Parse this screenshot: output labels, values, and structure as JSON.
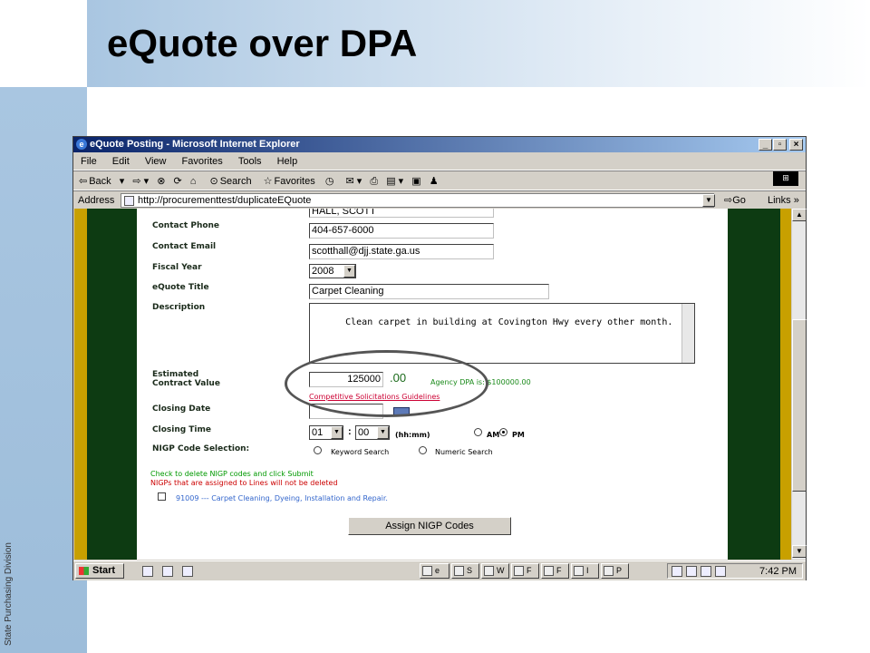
{
  "slide": {
    "title": "eQuote over DPA",
    "sidebar_label": "State Purchasing Division"
  },
  "window": {
    "title": "eQuote Posting - Microsoft Internet Explorer",
    "menu": [
      "File",
      "Edit",
      "View",
      "Favorites",
      "Tools",
      "Help"
    ],
    "toolbar": {
      "back": "Back",
      "search": "Search",
      "favorites": "Favorites"
    },
    "address": {
      "label": "Address",
      "url": "http://procurementtest/duplicateEQuote",
      "go": "Go",
      "links": "Links"
    }
  },
  "form": {
    "contact_name_value": "HALL, SCOTT",
    "contact_phone_label": "Contact Phone",
    "contact_phone_value": "404-657-6000",
    "contact_email_label": "Contact Email",
    "contact_email_value": "scotthall@djj.state.ga.us",
    "fiscal_year_label": "Fiscal Year",
    "fiscal_year_value": "2008",
    "equote_title_label": "eQuote Title",
    "equote_title_value": "Carpet Cleaning",
    "description_label": "Description",
    "description_value": "Clean carpet in building at Covington Hwy every other month.",
    "estimated_label_1": "Estimated",
    "estimated_label_2": "Contract Value",
    "estimated_value": "125000",
    "cents": ".00",
    "agency_dpa": "Agency DPA is: $100000.00",
    "guidelines_link": "Competitive Solicitations Guidelines",
    "closing_date_label": "Closing Date",
    "closing_time_label": "Closing Time",
    "hour_value": "01",
    "minute_value": "00",
    "time_colon": ":",
    "time_format": "(hh:mm)",
    "am_label": "AM",
    "pm_label": "PM",
    "nigp_label": "NIGP Code Selection:",
    "keyword_search": "Keyword Search",
    "numeric_search": "Numeric Search",
    "note_1": "Check to delete NIGP codes and click Submit",
    "note_2": "NIGPs that are assigned to Lines will not be deleted",
    "nigp_item": "91009 --- Carpet Cleaning, Dyeing, Installation and Repair.",
    "assign_button": "Assign NIGP Codes"
  },
  "taskbar": {
    "start": "Start",
    "buttons": [
      "e",
      "S",
      "W",
      "F",
      "F",
      "I",
      "P"
    ],
    "clock": "7:42 PM"
  },
  "colors": {
    "green_band": "#0d3b12",
    "gold_band": "#c8a000",
    "title_bar": "#0a246a",
    "note_green": "#009900",
    "note_red": "#cc0000",
    "link_red": "#cc0033",
    "item_blue": "#3366cc"
  }
}
